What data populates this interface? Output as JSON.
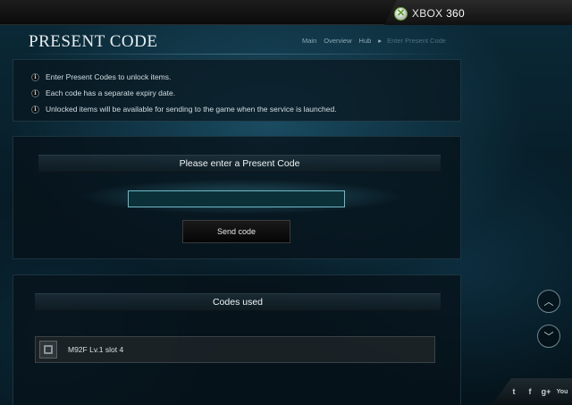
{
  "brand": {
    "xbox_label": "XBOX",
    "version_label": "360"
  },
  "header": {
    "title": "PRESENT CODE",
    "breadcrumb": [
      {
        "label": "Main"
      },
      {
        "label": "Overview"
      },
      {
        "label": "Hub"
      },
      {
        "label": "Enter Present Code"
      }
    ]
  },
  "info": {
    "items": [
      {
        "text": "Enter Present Codes to unlock items."
      },
      {
        "text": "Each code has a separate expiry date."
      },
      {
        "text": "Unlocked items will be available for sending to the game when the service is launched."
      }
    ]
  },
  "entry": {
    "heading": "Please enter a Present Code",
    "input_value": "",
    "send_label": "Send code"
  },
  "used": {
    "heading": "Codes used",
    "items": [
      {
        "name": "M92F Lv.1 slot 4"
      }
    ]
  },
  "nav": {
    "scroll_up": "︿",
    "scroll_down": "﹀"
  },
  "social": {
    "twitter": "t",
    "facebook": "f",
    "googleplus": "g+",
    "youtube": "You"
  },
  "colors": {
    "accent": "#6fb8c6",
    "background": "#071d28",
    "xbox_green": "#4e9a1e"
  }
}
